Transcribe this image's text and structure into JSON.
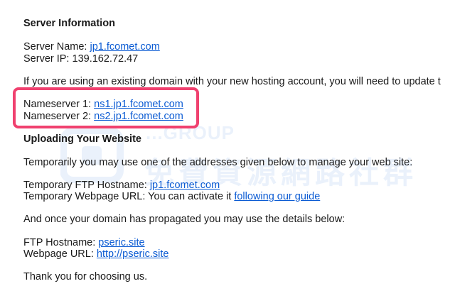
{
  "server_info": {
    "heading": "Server Information",
    "name_label": "Server Name: ",
    "name_value": "jp1.fcomet.com",
    "ip_label": "Server IP: ",
    "ip_value": "139.162.72.47"
  },
  "domain_note": "If you are using an existing domain with your new hosting account, you will need to update t",
  "nameservers": {
    "ns1_label": "Nameserver 1: ",
    "ns1_value": "ns1.jp1.fcomet.com",
    "ns2_label": "Nameserver 2: ",
    "ns2_value": "ns2.jp1.fcomet.com"
  },
  "uploading": {
    "heading": "Uploading Your Website",
    "intro": "Temporarily you may use one of the addresses given below to manage your web site:",
    "temp_ftp_label": "Temporary FTP Hostname: ",
    "temp_ftp_value": "jp1.fcomet.com",
    "temp_web_label": "Temporary Webpage URL: You can activate it ",
    "temp_web_link": "following our guide",
    "propagated": "And once your domain has propagated you may use the details below:",
    "ftp_label": "FTP Hostname: ",
    "ftp_value": "pseric.site",
    "web_label": "Webpage URL: ",
    "web_value": "http://pseric.site"
  },
  "closing": "Thank you for choosing us.",
  "watermark": {
    "brand": "...GROUP",
    "chinese": "免費資源網路社群"
  },
  "colors": {
    "link": "#0b5bd3",
    "highlight": "#f0416f"
  }
}
